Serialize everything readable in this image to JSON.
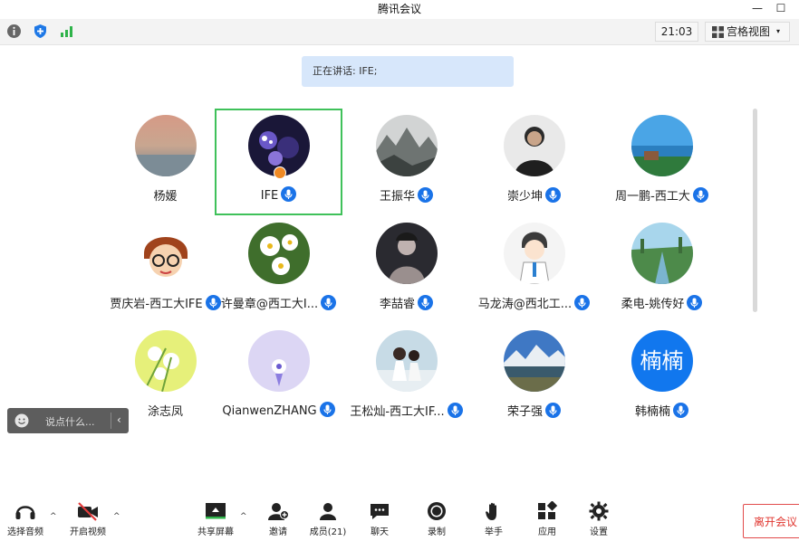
{
  "window": {
    "title": "腾讯会议",
    "min_icon": "minimize-icon",
    "max_icon": "maximize-icon"
  },
  "topbar": {
    "info_icon": "info-icon",
    "security_icon": "shield-icon",
    "signal_icon": "signal-icon",
    "clock": "21:03",
    "view_label": "宫格视图",
    "view_caret": "▾"
  },
  "speaking": {
    "text": "正在讲话: IFE;"
  },
  "participants": [
    {
      "name": "杨媛",
      "mic": false
    },
    {
      "name": "IFE",
      "mic": true,
      "active": true,
      "host": true
    },
    {
      "name": "王振华",
      "mic": true
    },
    {
      "name": "崇少坤",
      "mic": true
    },
    {
      "name": "周一鹏-西工大",
      "mic": true
    },
    {
      "name": "贾庆岩-西工大IFE",
      "mic": true
    },
    {
      "name": "许曼章@西工大I...",
      "mic": true
    },
    {
      "name": "李喆睿",
      "mic": true
    },
    {
      "name": "马龙涛@西北工...",
      "mic": true
    },
    {
      "name": "柔电-姚传好",
      "mic": true
    },
    {
      "name": "涂志凤",
      "mic": false
    },
    {
      "name": "QianwenZHANG",
      "mic": true
    },
    {
      "name": "王松灿-西工大IF...",
      "mic": true
    },
    {
      "name": "荣子强",
      "mic": true
    },
    {
      "name": "韩楠楠",
      "mic": true,
      "initials": "楠楠"
    }
  ],
  "chat": {
    "placeholder": "说点什么...",
    "collapse": "‹"
  },
  "toolbar": {
    "audio": "选择音频",
    "video": "开启视频",
    "share": "共享屏幕",
    "invite": "邀请",
    "members": "成员(21)",
    "chat": "聊天",
    "record": "录制",
    "raise_hand": "举手",
    "apps": "应用",
    "settings": "设置",
    "caret": "^",
    "leave": "离开会议"
  },
  "colors": {
    "accent": "#1177ee",
    "active_border": "#3fc15a",
    "leave": "#e0362f",
    "speaking_bg": "#d7e7fb"
  }
}
